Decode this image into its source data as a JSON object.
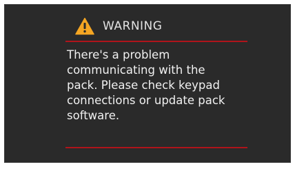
{
  "dialog": {
    "title": "WARNING",
    "icon": "warning-triangle-icon",
    "message": "There's a problem\ncommunicating with the\npack.  Please check keypad\nconnections or update pack\nsoftware."
  },
  "colors": {
    "background": "#2a2a2a",
    "accent_rule": "#b0141b",
    "warning_icon": "#f5a623",
    "text": "#f0f0f0"
  }
}
